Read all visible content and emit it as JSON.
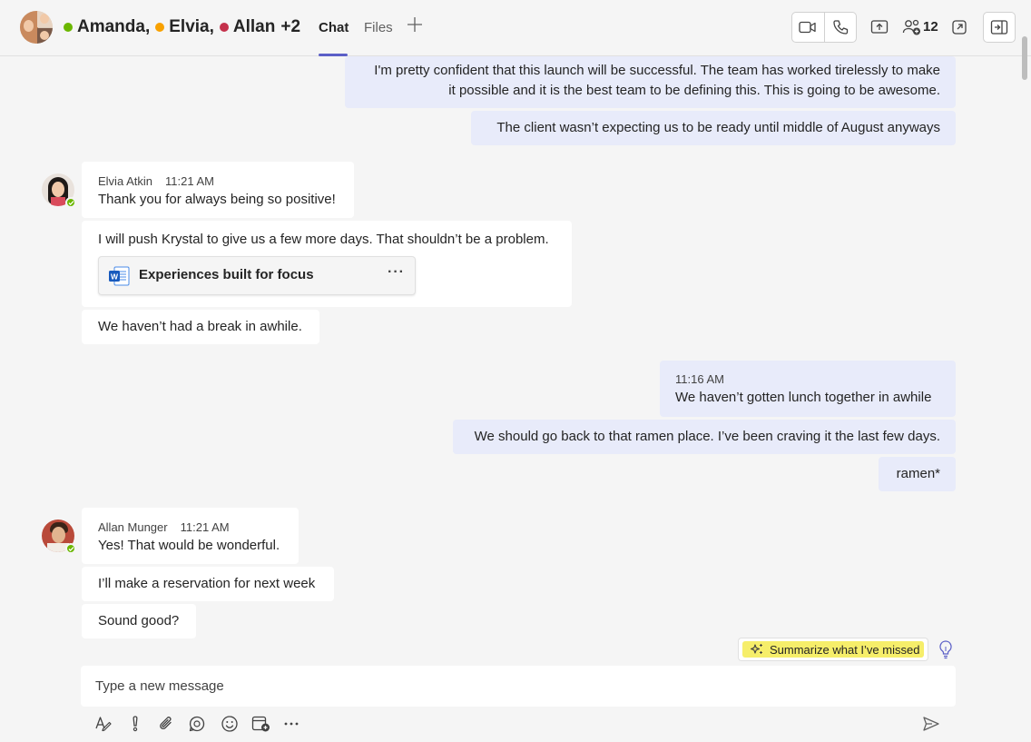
{
  "header": {
    "participants": [
      {
        "name": "Amanda,",
        "status": "available",
        "color": "#6bb700"
      },
      {
        "name": "Elvia,",
        "status": "away",
        "color": "#f8a100"
      },
      {
        "name": "Allan",
        "status": "busy",
        "color": "#c4314b"
      }
    ],
    "more_count": "+2",
    "tabs": [
      {
        "label": "Chat",
        "active": true
      },
      {
        "label": "Files",
        "active": false
      }
    ],
    "add_tab_icon": "plus-icon",
    "people_count": "12",
    "icons": [
      "video-call-icon",
      "audio-call-icon",
      "share-screen-icon",
      "people-icon",
      "pop-out-icon",
      "side-panel-icon"
    ]
  },
  "messages": {
    "mine1": {
      "lines": [
        "I'm pretty confident that this launch will be successful. The team has worked tirelessly to make",
        "it possible and it is the best team to be defining this. This is going to be awesome."
      ]
    },
    "mine2": {
      "text": "The client wasn’t expecting us to be ready until middle of August anyways"
    },
    "elvia": {
      "sender": "Elvia Atkin",
      "time": "11:21 AM",
      "msg1": "Thank you for always being so positive!",
      "msg2": "I will push Krystal to give us a few more days. That shouldn’t be a problem.",
      "file_name": "Experiences built for focus",
      "file_more": "···",
      "msg3": "We haven’t had a break in awhile."
    },
    "mine3": {
      "time": "11:16 AM",
      "text": "We haven’t gotten lunch together in awhile"
    },
    "mine4": {
      "text": "We should go back to that ramen place. I’ve been craving it the last few days."
    },
    "mine5": {
      "text": "ramen*"
    },
    "allan": {
      "sender": "Allan Munger",
      "time": "11:21 AM",
      "msg1": "Yes! That would be wonderful.",
      "msg2": "I’ll make a reservation for next week",
      "msg3": "Sound good?"
    }
  },
  "summarize": {
    "label": "Summarize what I’ve missed",
    "highlight": "#f6ee6a"
  },
  "compose": {
    "placeholder": "Type a new message"
  },
  "toolbar_icons": [
    "format-icon",
    "important-icon",
    "attach-icon",
    "loop-icon",
    "emoji-icon",
    "schedule-icon",
    "more-options-icon",
    "send-icon"
  ],
  "colors": {
    "accent": "#5b5fc7",
    "my_bubble": "#e8ebfa",
    "their_bubble": "#ffffff",
    "background": "#f5f5f5"
  }
}
